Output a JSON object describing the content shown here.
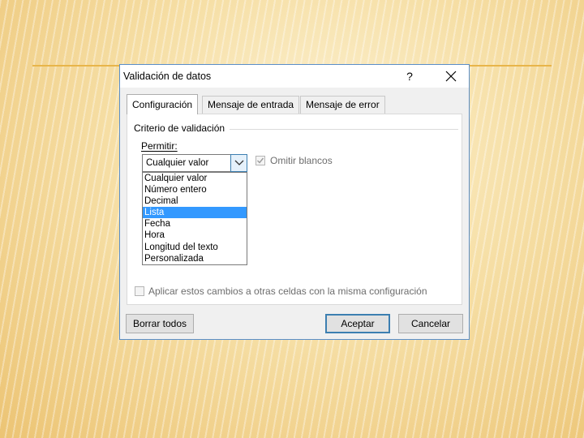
{
  "dialog": {
    "title": "Validación de datos",
    "help_label": "?",
    "close_label": "✕"
  },
  "tabs": [
    {
      "label": "Configuración",
      "active": true
    },
    {
      "label": "Mensaje de entrada",
      "active": false
    },
    {
      "label": "Mensaje de error",
      "active": false
    }
  ],
  "criteria": {
    "group_label": "Criterio de validación",
    "allow_label": "Permitir:",
    "allow_value": "Cualquier valor",
    "ignore_blank_label": "Omitir blancos",
    "ignore_blank_checked": true,
    "options": [
      "Cualquier valor",
      "Número entero",
      "Decimal",
      "Lista",
      "Fecha",
      "Hora",
      "Longitud del texto",
      "Personalizada"
    ],
    "highlighted_option": "Lista"
  },
  "apply_all": {
    "label": "Aplicar estos cambios a otras celdas con la misma configuración",
    "checked": false
  },
  "buttons": {
    "clear_all": "Borrar todos",
    "ok": "Aceptar",
    "cancel": "Cancelar"
  },
  "colors": {
    "accent": "#3c7fb1",
    "highlight": "#3399ff",
    "dialog_bg": "#f0f0f0",
    "slide_line": "#e8b54a"
  },
  "icons": {
    "dropdown": "chevron-down-icon",
    "check": "checkmark-icon",
    "close": "close-icon"
  }
}
